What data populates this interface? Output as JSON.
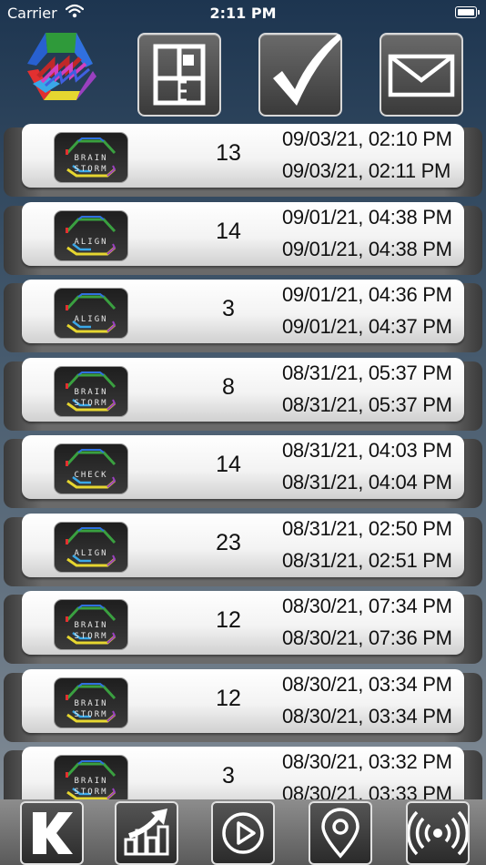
{
  "status_bar": {
    "carrier": "Carrier",
    "time": "2:11 PM"
  },
  "toolbar": {
    "buttons": [
      {
        "name": "layout-button",
        "icon": "layout-grid-icon"
      },
      {
        "name": "check-button",
        "icon": "checkmark-icon"
      },
      {
        "name": "mail-button",
        "icon": "envelope-icon"
      }
    ]
  },
  "sessions": [
    {
      "type": [
        "BRAIN",
        "STORM"
      ],
      "count": "13",
      "start": "09/03/21, 02:10 PM",
      "end": "09/03/21, 02:11 PM"
    },
    {
      "type": [
        "ALIGN"
      ],
      "count": "14",
      "start": "09/01/21, 04:38 PM",
      "end": "09/01/21, 04:38 PM"
    },
    {
      "type": [
        "ALIGN"
      ],
      "count": "3",
      "start": "09/01/21, 04:36 PM",
      "end": "09/01/21, 04:37 PM"
    },
    {
      "type": [
        "BRAIN",
        "STORM"
      ],
      "count": "8",
      "start": "08/31/21, 05:37 PM",
      "end": "08/31/21, 05:37 PM"
    },
    {
      "type": [
        "CHECK"
      ],
      "count": "14",
      "start": "08/31/21, 04:03 PM",
      "end": "08/31/21, 04:04 PM"
    },
    {
      "type": [
        "ALIGN"
      ],
      "count": "23",
      "start": "08/31/21, 02:50 PM",
      "end": "08/31/21, 02:51 PM"
    },
    {
      "type": [
        "BRAIN",
        "STORM"
      ],
      "count": "12",
      "start": "08/30/21, 07:34 PM",
      "end": "08/30/21, 07:36 PM"
    },
    {
      "type": [
        "BRAIN",
        "STORM"
      ],
      "count": "12",
      "start": "08/30/21, 03:34 PM",
      "end": "08/30/21, 03:34 PM"
    },
    {
      "type": [
        "BRAIN",
        "STORM"
      ],
      "count": "3",
      "start": "08/30/21, 03:32 PM",
      "end": "08/30/21, 03:33 PM"
    }
  ],
  "bottom_bar": {
    "buttons": [
      {
        "name": "k-button",
        "icon": "k-letter-icon"
      },
      {
        "name": "stats-button",
        "icon": "bar-chart-up-icon"
      },
      {
        "name": "play-button",
        "icon": "play-circle-icon"
      },
      {
        "name": "location-button",
        "icon": "map-pin-icon"
      },
      {
        "name": "broadcast-button",
        "icon": "broadcast-icon"
      }
    ]
  }
}
